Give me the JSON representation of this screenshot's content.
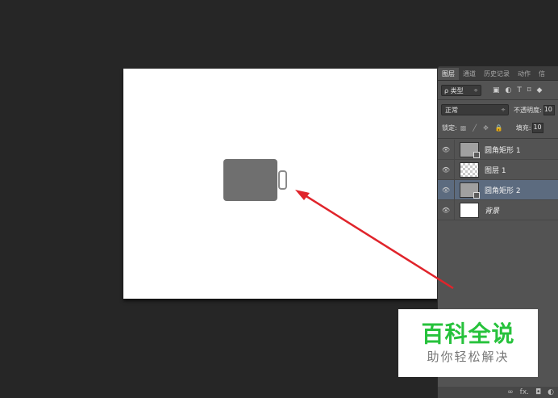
{
  "panel": {
    "tabs": [
      "图层",
      "通道",
      "历史记录",
      "动作",
      "信"
    ],
    "filter": {
      "label": "ρ 类型",
      "arrow": "÷",
      "icons": [
        "▣",
        "◐",
        "T",
        "⌑",
        "◆"
      ]
    },
    "blend_mode": "正常",
    "blend_arrow": "÷",
    "opacity_label": "不透明度:",
    "opacity_value": "10",
    "lock_label": "锁定:",
    "lock_icons": [
      "▩",
      "╱",
      "✥",
      "🔒"
    ],
    "fill_label": "填充:",
    "fill_value": "10",
    "layers": [
      {
        "name": "圆角矩形 1",
        "thumb": "shape",
        "selected": false
      },
      {
        "name": "图层 1",
        "thumb": "checker",
        "selected": false
      },
      {
        "name": "圆角矩形 2",
        "thumb": "shape",
        "selected": true
      },
      {
        "name": "背景",
        "thumb": "white",
        "selected": false
      }
    ],
    "bottom_icons": [
      "∞",
      "fx.",
      "◘",
      "◐"
    ]
  },
  "watermark": {
    "title": "百科全说",
    "subtitle": "助你轻松解决"
  },
  "colors": {
    "workspace": "#262626",
    "panel": "#535353",
    "selected_layer": "#5c6b7f",
    "arrow": "#e0242b",
    "watermark_green": "#27c23c"
  }
}
